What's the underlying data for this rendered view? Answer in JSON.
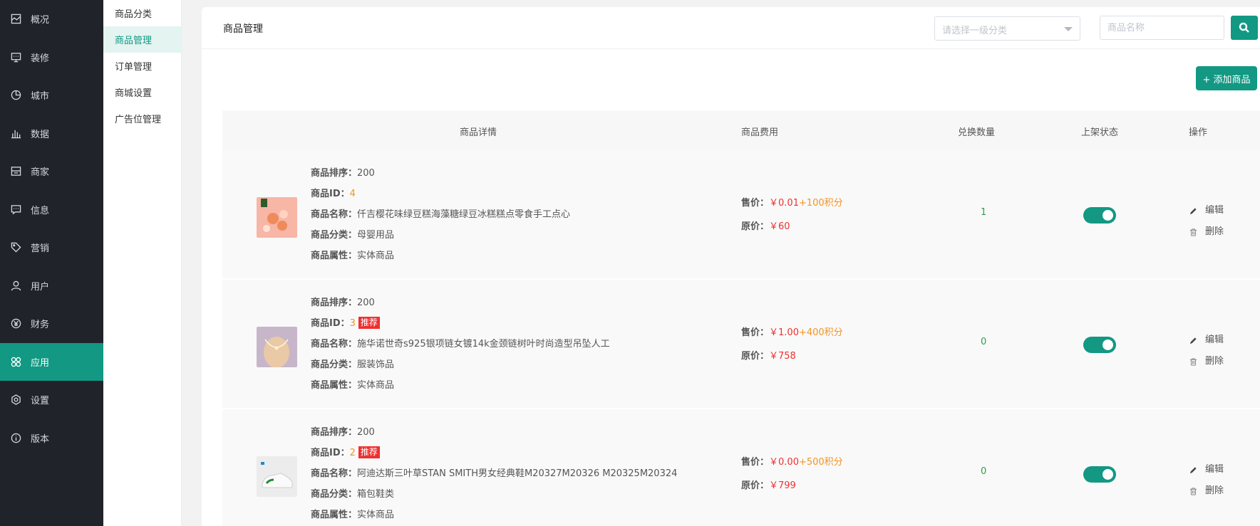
{
  "nav": {
    "items": [
      {
        "label": "概况",
        "icon": "overview-icon"
      },
      {
        "label": "装修",
        "icon": "decorate-icon"
      },
      {
        "label": "城市",
        "icon": "city-icon"
      },
      {
        "label": "数据",
        "icon": "chart-icon"
      },
      {
        "label": "商家",
        "icon": "merchant-icon"
      },
      {
        "label": "信息",
        "icon": "message-icon"
      },
      {
        "label": "营销",
        "icon": "tag-icon"
      },
      {
        "label": "用户",
        "icon": "user-icon"
      },
      {
        "label": "财务",
        "icon": "finance-icon"
      },
      {
        "label": "应用",
        "icon": "apps-icon"
      },
      {
        "label": "设置",
        "icon": "gear-icon"
      },
      {
        "label": "版本",
        "icon": "info-icon"
      }
    ],
    "active_index": 9
  },
  "subnav": {
    "items": [
      "商品分类",
      "商品管理",
      "订单管理",
      "商城设置",
      "广告位管理"
    ],
    "active_index": 1
  },
  "header": {
    "title": "商品管理",
    "category_placeholder": "请选择一级分类",
    "search_placeholder": "商品名称"
  },
  "toolbar": {
    "add_label": "+ 添加商品"
  },
  "table": {
    "headers": [
      "商品详情",
      "商品费用",
      "兑换数量",
      "上架状态",
      "操作"
    ],
    "labels": {
      "sort": "商品排序：",
      "id": "商品ID：",
      "name": "商品名称：",
      "category": "商品分类：",
      "attr": "商品属性：",
      "sale": "售价：",
      "orig": "原价：",
      "recommend": "推荐",
      "edit": "编辑",
      "delete": "删除"
    },
    "rows": [
      {
        "sort": "200",
        "id": "4",
        "name": "仟吉樱花味绿豆糕海藻糖绿豆冰糕糕点零食手工点心",
        "category": "母婴用品",
        "attr": "实体商品",
        "sale_price": "￥0.01",
        "points": "+100积分",
        "orig_price": "￥60",
        "count": "1",
        "on_shelf": true,
        "recommend": false
      },
      {
        "sort": "200",
        "id": "3",
        "name": "施华诺世奇s925银项链女镀14k金颈链树叶时尚造型吊坠人工",
        "category": "服装饰品",
        "attr": "实体商品",
        "sale_price": "￥1.00",
        "points": "+400积分",
        "orig_price": "￥758",
        "count": "0",
        "on_shelf": true,
        "recommend": true
      },
      {
        "sort": "200",
        "id": "2",
        "name": "阿迪达斯三叶草STAN SMITH男女经典鞋M20327M20326 M20325M20324",
        "category": "箱包鞋类",
        "attr": "实体商品",
        "sale_price": "￥0.00",
        "points": "+500积分",
        "orig_price": "￥799",
        "count": "0",
        "on_shelf": true,
        "recommend": true
      }
    ]
  },
  "colors": {
    "accent": "#129883",
    "nav_bg": "#20232a",
    "price_red": "#f0302f",
    "points_orange": "#f39323"
  }
}
